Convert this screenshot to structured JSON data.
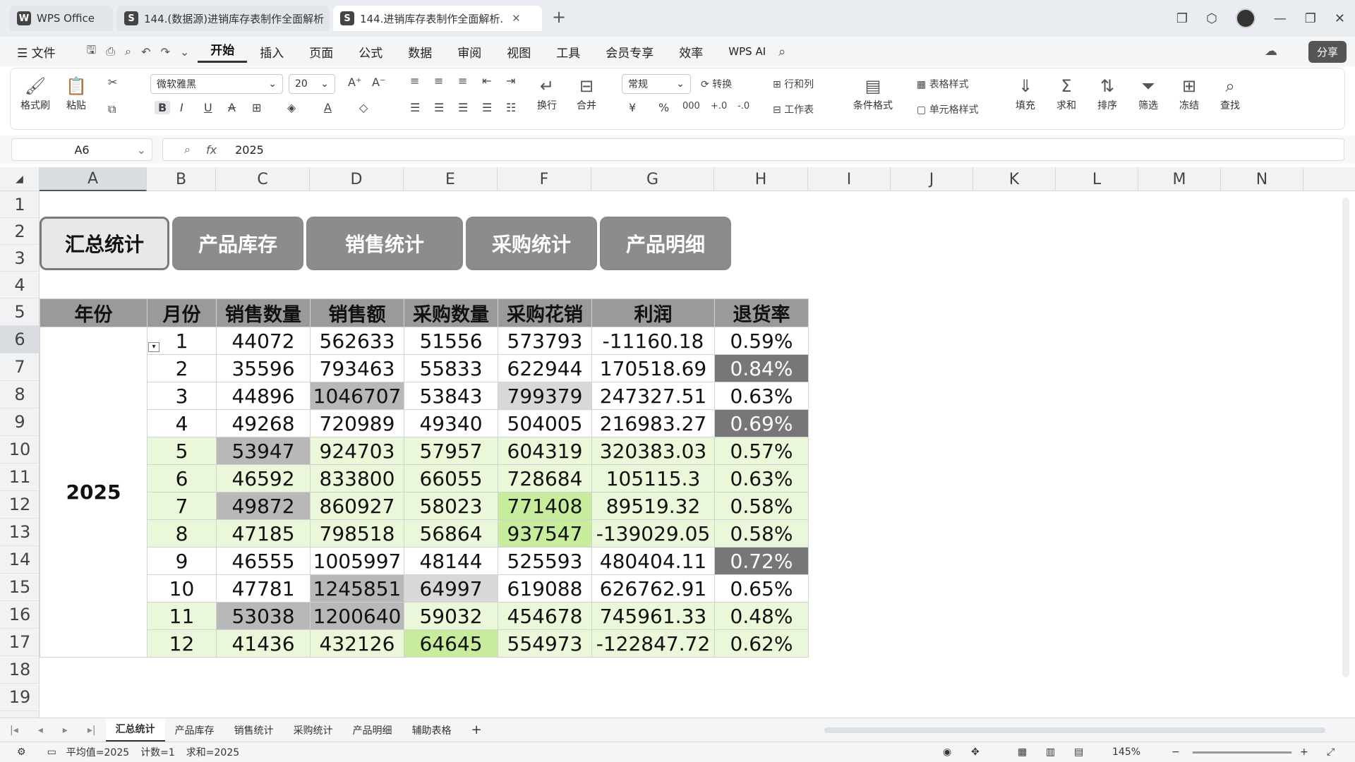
{
  "titlebar": {
    "tabs": [
      {
        "label": "WPS Office",
        "logo": "W"
      },
      {
        "label": "144.(数据源)进销库存表制作全面解析",
        "logo": "S"
      },
      {
        "label": "144.进销库存表制作全面解析.",
        "logo": "S"
      }
    ]
  },
  "menu": {
    "file": "文件",
    "items": [
      "开始",
      "插入",
      "页面",
      "公式",
      "数据",
      "审阅",
      "视图",
      "工具",
      "会员专享",
      "效率"
    ],
    "wps_ai": "WPS AI",
    "share": "分享"
  },
  "ribbon": {
    "format_painter": "格式刷",
    "paste": "粘贴",
    "font": "微软雅黑",
    "font_size": "20",
    "wrap": "换行",
    "merge": "合并",
    "number_format": "常规",
    "convert": "转换",
    "row_col": "行和列",
    "worksheet": "工作表",
    "conditional": "条件格式",
    "table_style": "表格样式",
    "cell_style": "单元格样式",
    "fill": "填充",
    "sum": "求和",
    "sort": "排序",
    "filter": "筛选",
    "freeze": "冻结",
    "find": "查找"
  },
  "formula": {
    "cell_ref": "A6",
    "fx": "fx",
    "value": "2025"
  },
  "columns": [
    "A",
    "B",
    "C",
    "D",
    "E",
    "F",
    "G",
    "H",
    "I",
    "J",
    "K",
    "L",
    "M",
    "N"
  ],
  "rows": [
    "1",
    "2",
    "3",
    "4",
    "5",
    "6",
    "7",
    "8",
    "9",
    "10",
    "11",
    "12",
    "13",
    "14",
    "15",
    "16",
    "17",
    "18",
    "19"
  ],
  "nav_buttons": [
    "汇总统计",
    "产品库存",
    "销售统计",
    "采购统计",
    "产品明细"
  ],
  "table": {
    "headers": [
      "年份",
      "月份",
      "销售数量",
      "销售额",
      "采购数量",
      "采购花销",
      "利润",
      "退货率"
    ],
    "year": "2025",
    "rows": [
      [
        "1",
        "44072",
        "562633",
        "51556",
        "573793",
        "-11160.18",
        "0.59%"
      ],
      [
        "2",
        "35596",
        "793463",
        "55833",
        "622944",
        "170518.69",
        "0.84%"
      ],
      [
        "3",
        "44896",
        "1046707",
        "53843",
        "799379",
        "247327.51",
        "0.63%"
      ],
      [
        "4",
        "49268",
        "720989",
        "49340",
        "504005",
        "216983.27",
        "0.69%"
      ],
      [
        "5",
        "53947",
        "924703",
        "57957",
        "604319",
        "320383.03",
        "0.57%"
      ],
      [
        "6",
        "46592",
        "833800",
        "66055",
        "728684",
        "105115.3",
        "0.63%"
      ],
      [
        "7",
        "49872",
        "860927",
        "58023",
        "771408",
        "89519.32",
        "0.58%"
      ],
      [
        "8",
        "47185",
        "798518",
        "56864",
        "937547",
        "-139029.05",
        "0.58%"
      ],
      [
        "9",
        "46555",
        "1005997",
        "48144",
        "525593",
        "480404.11",
        "0.72%"
      ],
      [
        "10",
        "47781",
        "1245851",
        "64997",
        "619088",
        "626762.91",
        "0.65%"
      ],
      [
        "11",
        "53038",
        "1200640",
        "59032",
        "454678",
        "745961.33",
        "0.48%"
      ],
      [
        "12",
        "41436",
        "432126",
        "64645",
        "554973",
        "-122847.72",
        "0.62%"
      ]
    ]
  },
  "sheet_tabs": [
    "汇总统计",
    "产品库存",
    "销售统计",
    "采购统计",
    "产品明细",
    "辅助表格"
  ],
  "status": {
    "average": "平均值=2025",
    "count": "计数=1",
    "sum": "求和=2025",
    "zoom": "145%"
  }
}
